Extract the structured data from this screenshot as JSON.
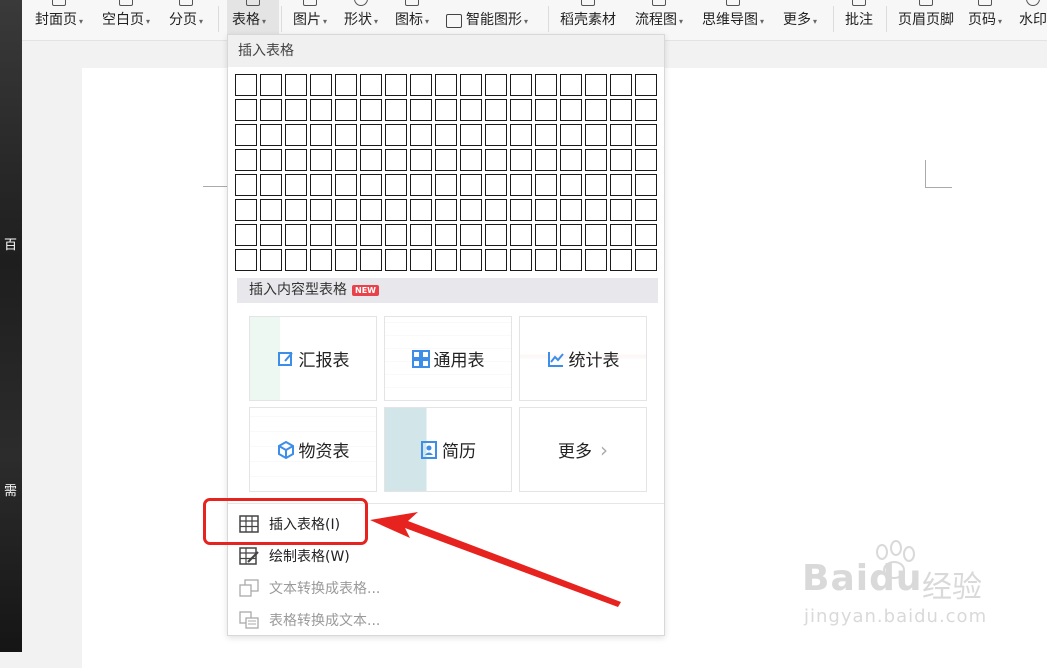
{
  "left_strip": {
    "chars": [
      "百",
      "需"
    ]
  },
  "toolbar": {
    "items": [
      {
        "label": "封面页",
        "caret": true
      },
      {
        "label": "空白页",
        "caret": true
      },
      {
        "label": "分页",
        "caret": true
      },
      {
        "label": "表格",
        "caret": true,
        "active": true
      },
      {
        "label": "图片",
        "caret": true
      },
      {
        "label": "形状",
        "caret": true
      },
      {
        "label": "图标",
        "caret": true
      },
      {
        "label": "智能图形",
        "caret": true
      },
      {
        "label": "稻壳素材",
        "caret": false
      },
      {
        "label": "流程图",
        "caret": true
      },
      {
        "label": "思维导图",
        "caret": true
      },
      {
        "label": "更多",
        "caret": true
      },
      {
        "label": "批注",
        "caret": false
      },
      {
        "label": "页眉页脚",
        "caret": false
      },
      {
        "label": "页码",
        "caret": true
      },
      {
        "label": "水印",
        "caret": false
      }
    ],
    "caret_glyph": "▾"
  },
  "dropdown": {
    "header": "插入表格",
    "grid": {
      "columns": 17,
      "rows": 8
    },
    "content_section": {
      "label": "插入内容型表格",
      "badge": "NEW"
    },
    "cards": [
      {
        "label": "汇报表",
        "icon": "edit-chart-icon"
      },
      {
        "label": "通用表",
        "icon": "grid-four-icon"
      },
      {
        "label": "统计表",
        "icon": "line-chart-icon"
      },
      {
        "label": "物资表",
        "icon": "cube-icon"
      },
      {
        "label": "简历",
        "icon": "resume-icon"
      },
      {
        "label": "更多",
        "icon": "chevron-right-icon"
      }
    ],
    "more_chevron": "›",
    "menu": [
      {
        "label": "插入表格(I)",
        "enabled": true,
        "icon": "table-icon"
      },
      {
        "label": "绘制表格(W)",
        "enabled": true,
        "icon": "draw-table-icon"
      },
      {
        "label": "文本转换成表格...",
        "enabled": false,
        "icon": "text-to-table-icon"
      },
      {
        "label": "表格转换成文本...",
        "enabled": false,
        "icon": "table-to-text-icon"
      }
    ]
  },
  "watermark": {
    "brand": "Baidu",
    "brand_cn": "经验",
    "url": "jingyan.baidu.com"
  },
  "colors": {
    "highlight": "#e6231f",
    "accent_blue": "#3d8ee8",
    "badge": "#e8424a"
  }
}
